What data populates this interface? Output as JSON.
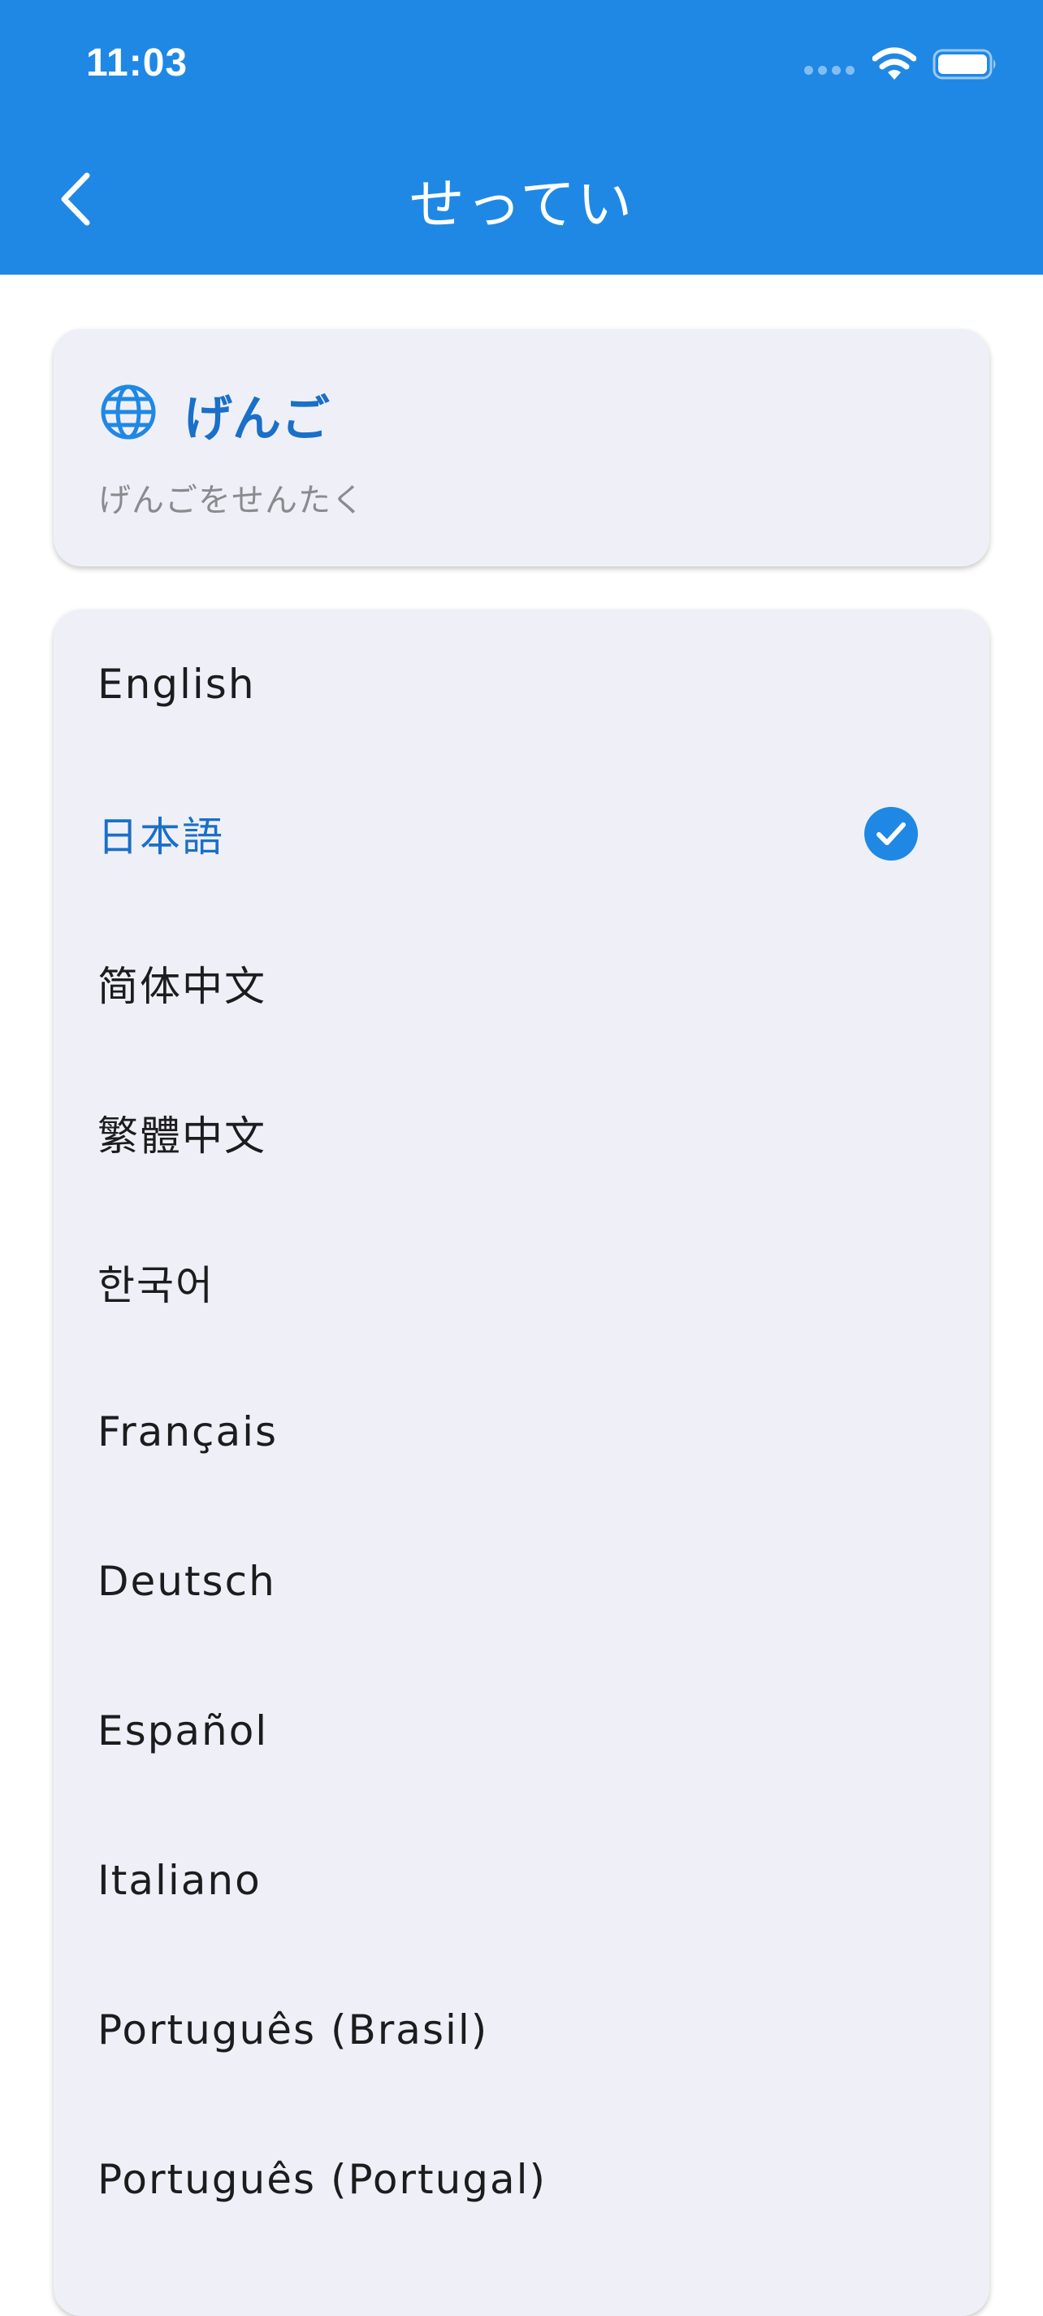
{
  "status_bar": {
    "time": "11:03",
    "icons": [
      "signal-dots-icon",
      "wifi-icon",
      "battery-icon"
    ]
  },
  "app_bar": {
    "title": "せってい",
    "back_icon": "chevron-left-icon"
  },
  "language_section": {
    "icon": "globe-icon",
    "title": "げんご",
    "subtitle": "げんごをせんたく"
  },
  "languages": [
    {
      "label": "English",
      "selected": false
    },
    {
      "label": "日本語",
      "selected": true
    },
    {
      "label": "简体中文",
      "selected": false
    },
    {
      "label": "繁體中文",
      "selected": false
    },
    {
      "label": "한국어",
      "selected": false
    },
    {
      "label": "Français",
      "selected": false
    },
    {
      "label": "Deutsch",
      "selected": false
    },
    {
      "label": "Español",
      "selected": false
    },
    {
      "label": "Italiano",
      "selected": false
    },
    {
      "label": "Português (Brasil)",
      "selected": false
    },
    {
      "label": "Português (Portugal)",
      "selected": false
    }
  ],
  "colors": {
    "app_bar": "#1F88E5",
    "accent": "#1A6FC9",
    "card_background": "#EFF0F7",
    "subtitle_text": "#8A8A8F"
  }
}
